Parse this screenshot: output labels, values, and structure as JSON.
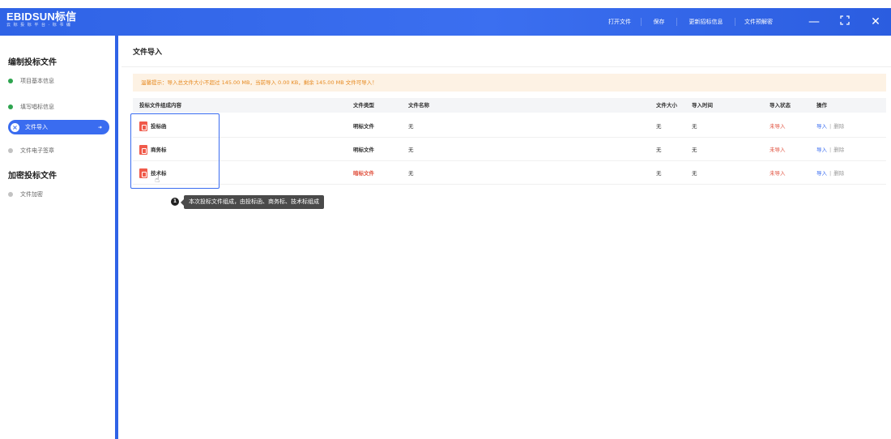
{
  "brand": {
    "name": "EBIDSUN标信",
    "tagline": "云 标 投 标 平 台 · 标 书 编"
  },
  "top_actions": [
    "打开文件",
    "保存",
    "更新招标信息",
    "文件预解密"
  ],
  "window_controls": {
    "minimize": "—",
    "maximize": "⛶",
    "close": "✕"
  },
  "sidebar": {
    "sections": [
      {
        "title": "编制投标文件",
        "items": [
          {
            "label": "项目基本信息",
            "status": "done"
          },
          {
            "label": "填写唱标信息",
            "status": "done"
          },
          {
            "label": "文件导入",
            "status": "active"
          },
          {
            "label": "文件电子签章",
            "status": "pending"
          }
        ]
      },
      {
        "title": "加密投标文件",
        "items": [
          {
            "label": "文件加密",
            "status": "pending"
          }
        ]
      }
    ]
  },
  "main": {
    "title": "文件导入",
    "notice": "温馨提示：导入总文件大小不超过 145.00 MB，当前导入 0.00 KB，剩余 145.00 MB 文件可导入！",
    "table": {
      "headers": [
        "投标文件组成内容",
        "文件类型",
        "文件名称",
        "文件大小",
        "导入时间",
        "导入状态",
        "操作"
      ],
      "rows": [
        {
          "content": "投标函",
          "type": "明标文件",
          "name": "无",
          "size": "无",
          "time": "无",
          "status": "未导入",
          "import": "导入",
          "delete": "删除"
        },
        {
          "content": "商务标",
          "type": "明标文件",
          "name": "无",
          "size": "无",
          "time": "无",
          "status": "未导入",
          "import": "导入",
          "delete": "删除"
        },
        {
          "content": "技术标",
          "type": "暗标文件",
          "name": "无",
          "size": "无",
          "time": "无",
          "status": "未导入",
          "import": "导入",
          "delete": "删除"
        }
      ]
    },
    "annotation": {
      "step": "1",
      "text": "本次投标文件组成，由投标函、商务标、技术标组成"
    }
  },
  "colors": {
    "primary": "#3a6cf0",
    "warning_bg": "#fdf2e4",
    "warning_text": "#e6891f",
    "danger": "#e0523f",
    "success": "#2ea44f"
  }
}
